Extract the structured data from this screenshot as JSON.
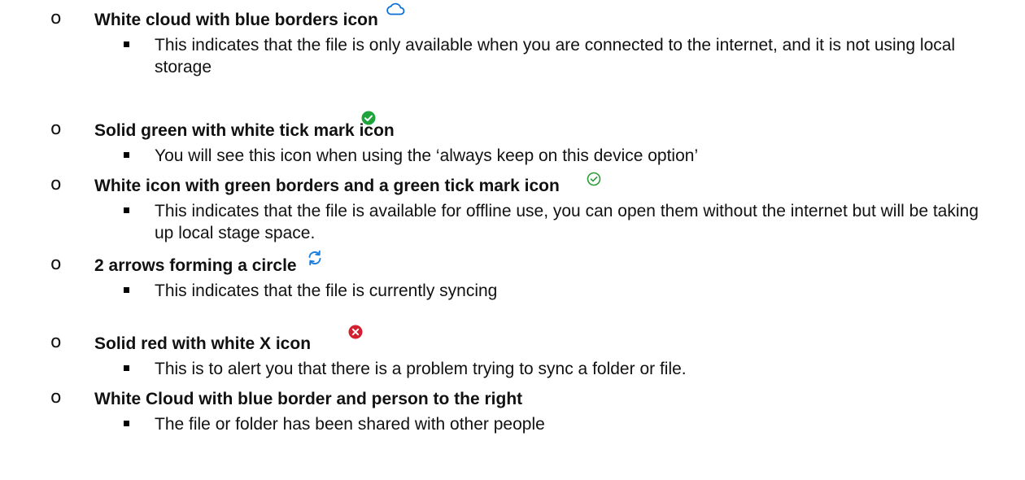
{
  "items": [
    {
      "heading": "White cloud with blue borders icon",
      "description": "This indicates that the file is only available when you are connected to the internet, and it is not using local storage",
      "icon": "cloud-outline-icon",
      "icon_color": "#0a6fd6"
    },
    {
      "heading": "Solid green with white tick mark icon",
      "description": "You will see this icon when using the ‘always keep on this device option’",
      "icon": "solid-green-check-icon",
      "icon_color": "#1fa33a"
    },
    {
      "heading": "White icon with green borders and a green tick mark icon",
      "description": "This indicates that the file is available for offline use, you can open them without the internet but will be taking up local stage space.",
      "icon": "outline-green-check-icon",
      "icon_color": "#2a9d3a"
    },
    {
      "heading": "2 arrows forming a circle",
      "description": "This indicates that the file is currently syncing",
      "icon": "sync-arrows-icon",
      "icon_color": "#1c7fe0"
    },
    {
      "heading": "Solid red with white X icon",
      "description": "This is to alert you that there is a problem trying to sync a folder or file.",
      "icon": "solid-red-x-icon",
      "icon_color": "#d3202f"
    },
    {
      "heading": "White Cloud with blue border and person to the right",
      "description": "The file or folder has been shared with other people"
    }
  ]
}
